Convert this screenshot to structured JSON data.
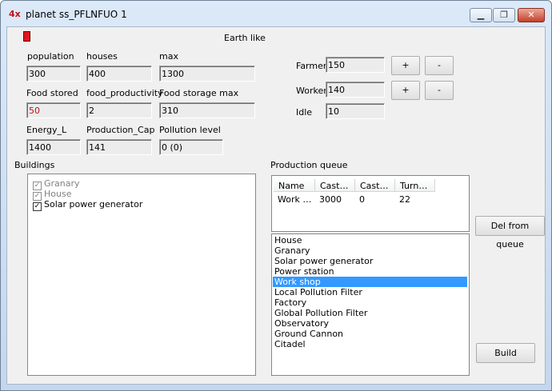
{
  "window": {
    "icon_text": "4x",
    "title": "planet ss_PFLNFUO 1",
    "controls": {
      "minimize": "▁",
      "maximize": "❐",
      "close": "✕"
    }
  },
  "planet": {
    "flag_color": "#e0161f",
    "climate": "Earth like"
  },
  "stats": {
    "population_label": "population",
    "population": "300",
    "houses_label": "houses",
    "houses": "400",
    "max_label": "max",
    "max": "1300",
    "food_stored_label": "Food stored",
    "food_stored": "50",
    "food_productivity_label": "food_productivity",
    "food_productivity": "2",
    "food_storage_max_label": "Food storage max",
    "food_storage_max": "310",
    "energy_label": "Energy_L",
    "energy": "1400",
    "production_cap_label": "Production_Cap",
    "production_cap": "141",
    "pollution_label": "Pollution level",
    "pollution": "0 (0)"
  },
  "workforce": {
    "farmers_label": "Farmers",
    "farmers": "150",
    "workers_label": "Workers",
    "workers": "140",
    "idle_label": "Idle",
    "idle": "10",
    "plus": "+",
    "minus": "-"
  },
  "buildings": {
    "label": "Buildings",
    "items": [
      {
        "name": "Granary",
        "checked": true,
        "enabled": false
      },
      {
        "name": "House",
        "checked": true,
        "enabled": false
      },
      {
        "name": "Solar power generator",
        "checked": true,
        "enabled": true
      }
    ]
  },
  "production_queue": {
    "label": "Production queue",
    "columns": [
      "Name",
      "Cast…",
      "Cast…",
      "Turn…"
    ],
    "rows": [
      [
        "Work …",
        "3000",
        "0",
        "22"
      ]
    ],
    "del_button": "Del from queue"
  },
  "build_list": {
    "items": [
      "House",
      "Granary",
      "Solar power generator",
      "Power station",
      "Work shop",
      "Local Pollution Filter",
      "Factory",
      "Global Pollution Filter",
      "Observatory",
      "Ground Cannon",
      "Citadel"
    ],
    "selected": "Work shop"
  },
  "build_button": "Build"
}
